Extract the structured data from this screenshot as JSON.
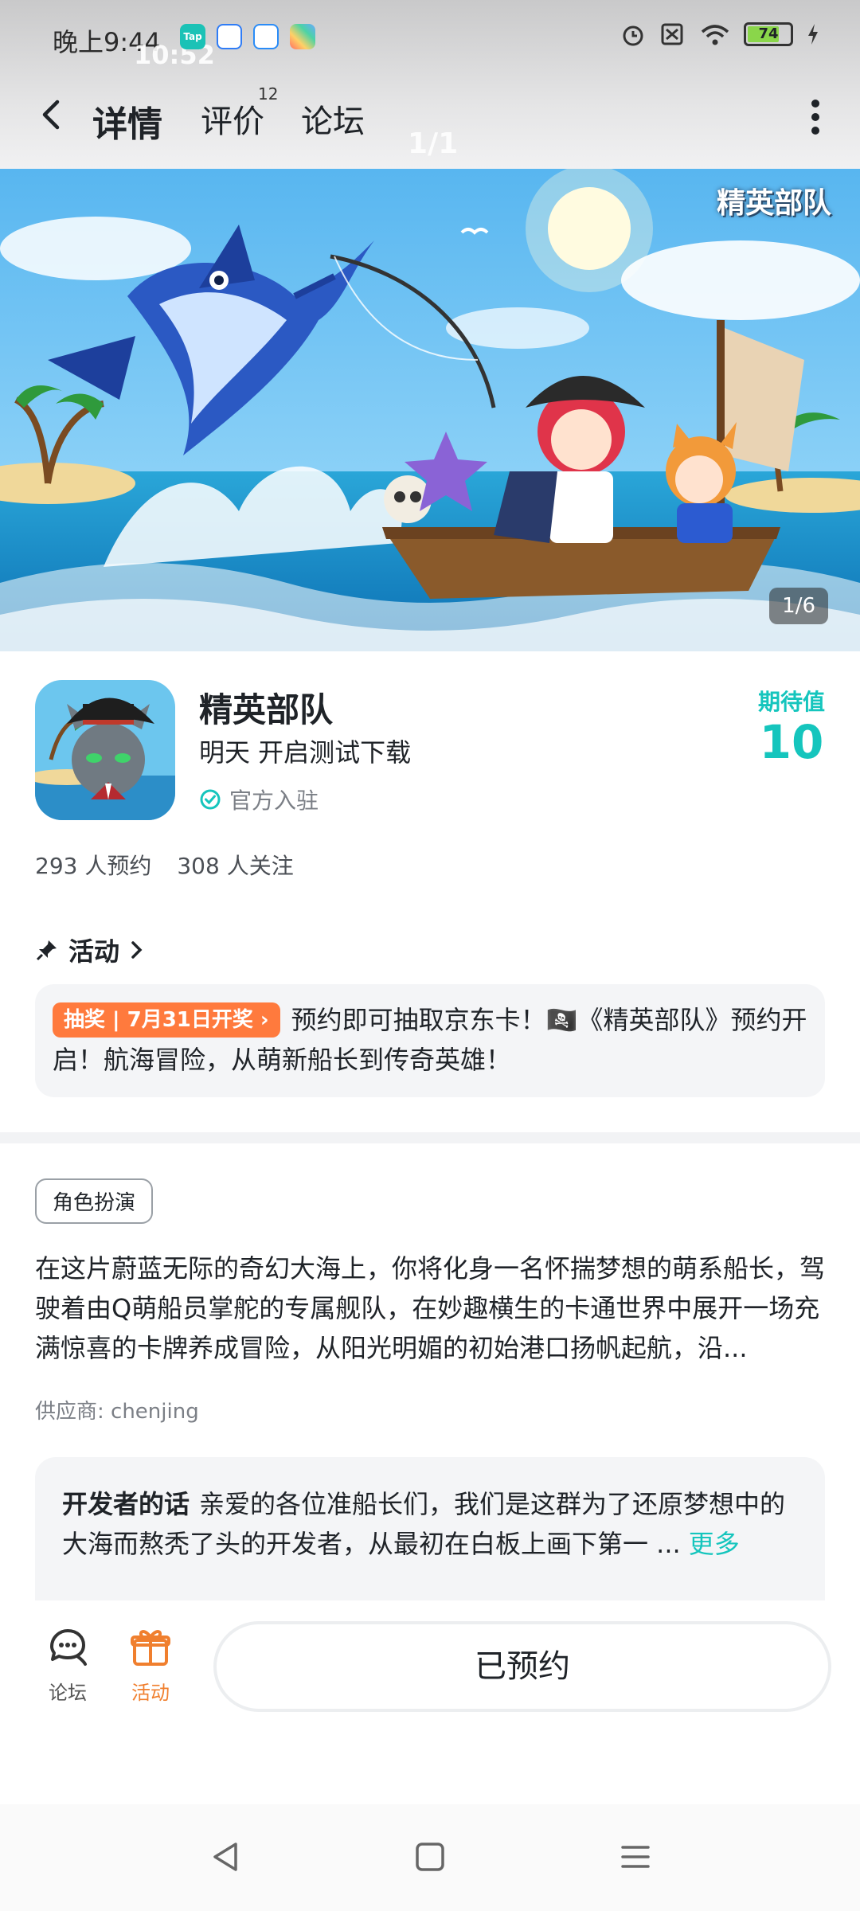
{
  "status_bar": {
    "time": "晚上9:44",
    "time_overlay": "10:52",
    "app_icons": [
      {
        "name": "tap-icon",
        "label": "Tap",
        "color": "#1bc2b6"
      },
      {
        "name": "app-blue-icon",
        "color": "#2f7cf6"
      },
      {
        "name": "app-cloud-icon",
        "color": "#2a8cf7"
      },
      {
        "name": "app-colorful-icon",
        "color": "#ff6f61"
      }
    ],
    "battery": "74"
  },
  "nav": {
    "tabs": [
      {
        "label": "详情",
        "active": true
      },
      {
        "label": "评价",
        "badge": "12"
      },
      {
        "label": "论坛"
      }
    ],
    "page_indicator": "1/1"
  },
  "banner": {
    "logo_text": "精英部队",
    "counter": "1/6"
  },
  "game": {
    "name": "精英部队",
    "subtitle": "明天 开启测试下载",
    "official": "官方入驻",
    "expect_label": "期待值",
    "expect_value": "10",
    "reservations": "293 人预约",
    "followers": "308 人关注"
  },
  "activity": {
    "heading": "活动",
    "tag": "抽奖 | 7月31日开奖 ›",
    "text": "预约即可抽取京东卡！🏴‍☠️《精英部队》预约开启！航海冒险，从萌新船长到传奇英雄！"
  },
  "description": {
    "genre": "角色扮演",
    "text": "在这片蔚蓝无际的奇幻大海上，你将化身一名怀揣梦想的萌系船长，驾驶着由Q萌船员掌舵的专属舰队，在妙趣横生的卡通世界中展开一场充满惊喜的卡牌养成冒险，从阳光明媚的初始港口扬帆起航，沿...",
    "supplier": "供应商: chenjing"
  },
  "developer": {
    "title": "开发者的话",
    "text": "亲爱的各位准船长们，我们是这群为了还原梦想中的大海而熬秃了头的开发者，从最初在白板上画下第一 ...",
    "more": "更多"
  },
  "action_bar": {
    "forum_label": "论坛",
    "activity_label": "活动",
    "activity_color": "#f07f2e",
    "reserved_label": "已预约"
  },
  "colors": {
    "accent": "#15c5bd",
    "lottery": "#ff7a3d"
  }
}
